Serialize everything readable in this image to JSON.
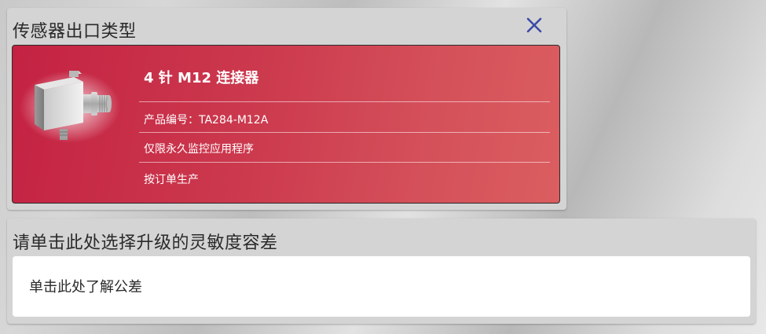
{
  "sensor_panel": {
    "title": "传感器出口类型",
    "close_icon": "close-icon",
    "product": {
      "name": "4 针 M12 连接器",
      "part_number": "产品编号：TA284-M12A",
      "note": "仅限永久监控应用程序",
      "production": "按订单生产",
      "image_icon": "sensor-connector-image"
    },
    "colors": {
      "card_start": "#c42242",
      "card_end": "#db5e60",
      "close": "#3d4aa8"
    }
  },
  "upgrade_panel": {
    "title": "请单击此处选择升级的灵敏度容差",
    "link": "单击此处了解公差"
  }
}
